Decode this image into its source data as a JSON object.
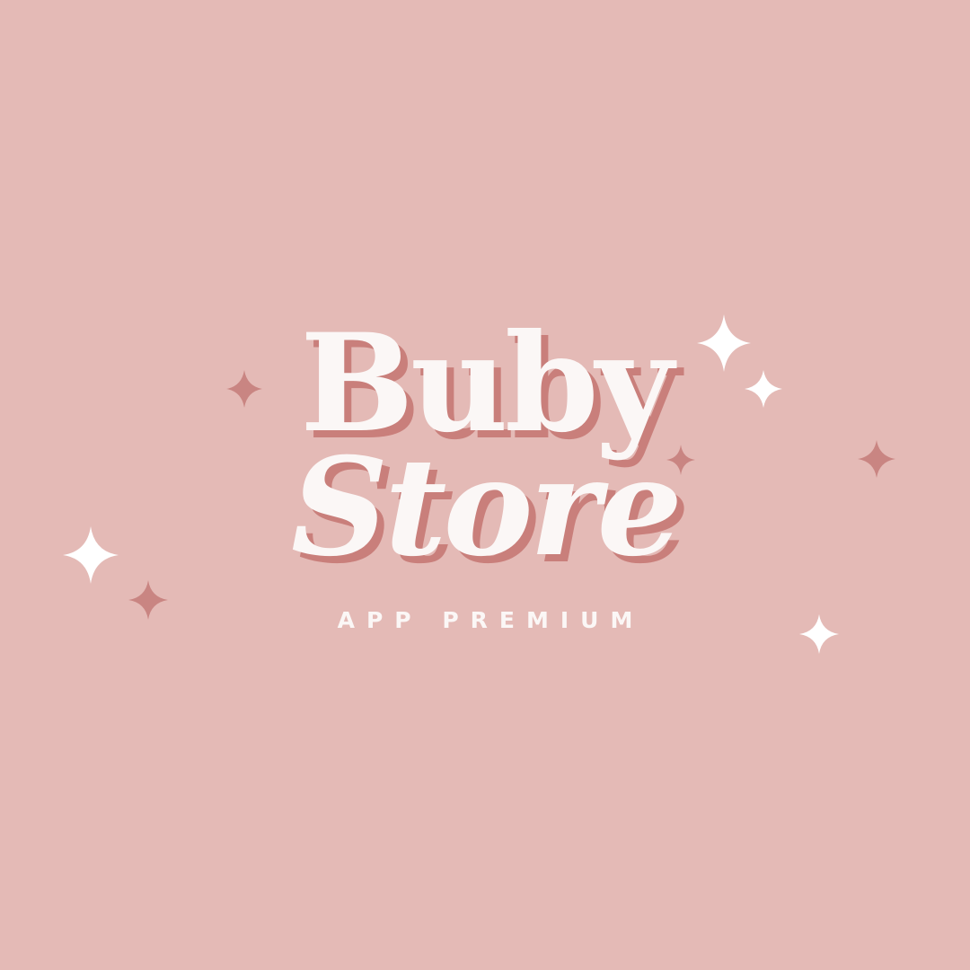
{
  "brand": {
    "line1": "Buby",
    "line2": "Store",
    "tagline": "APP PREMIUM"
  },
  "colors": {
    "background": "#e4bab6",
    "text": "#fbf7f6",
    "shadow": "#c97f7b",
    "sparkle_light": "#ffffff",
    "sparkle_dark": "#c98582"
  },
  "decorations": {
    "icon": "sparkle-star-icon"
  }
}
